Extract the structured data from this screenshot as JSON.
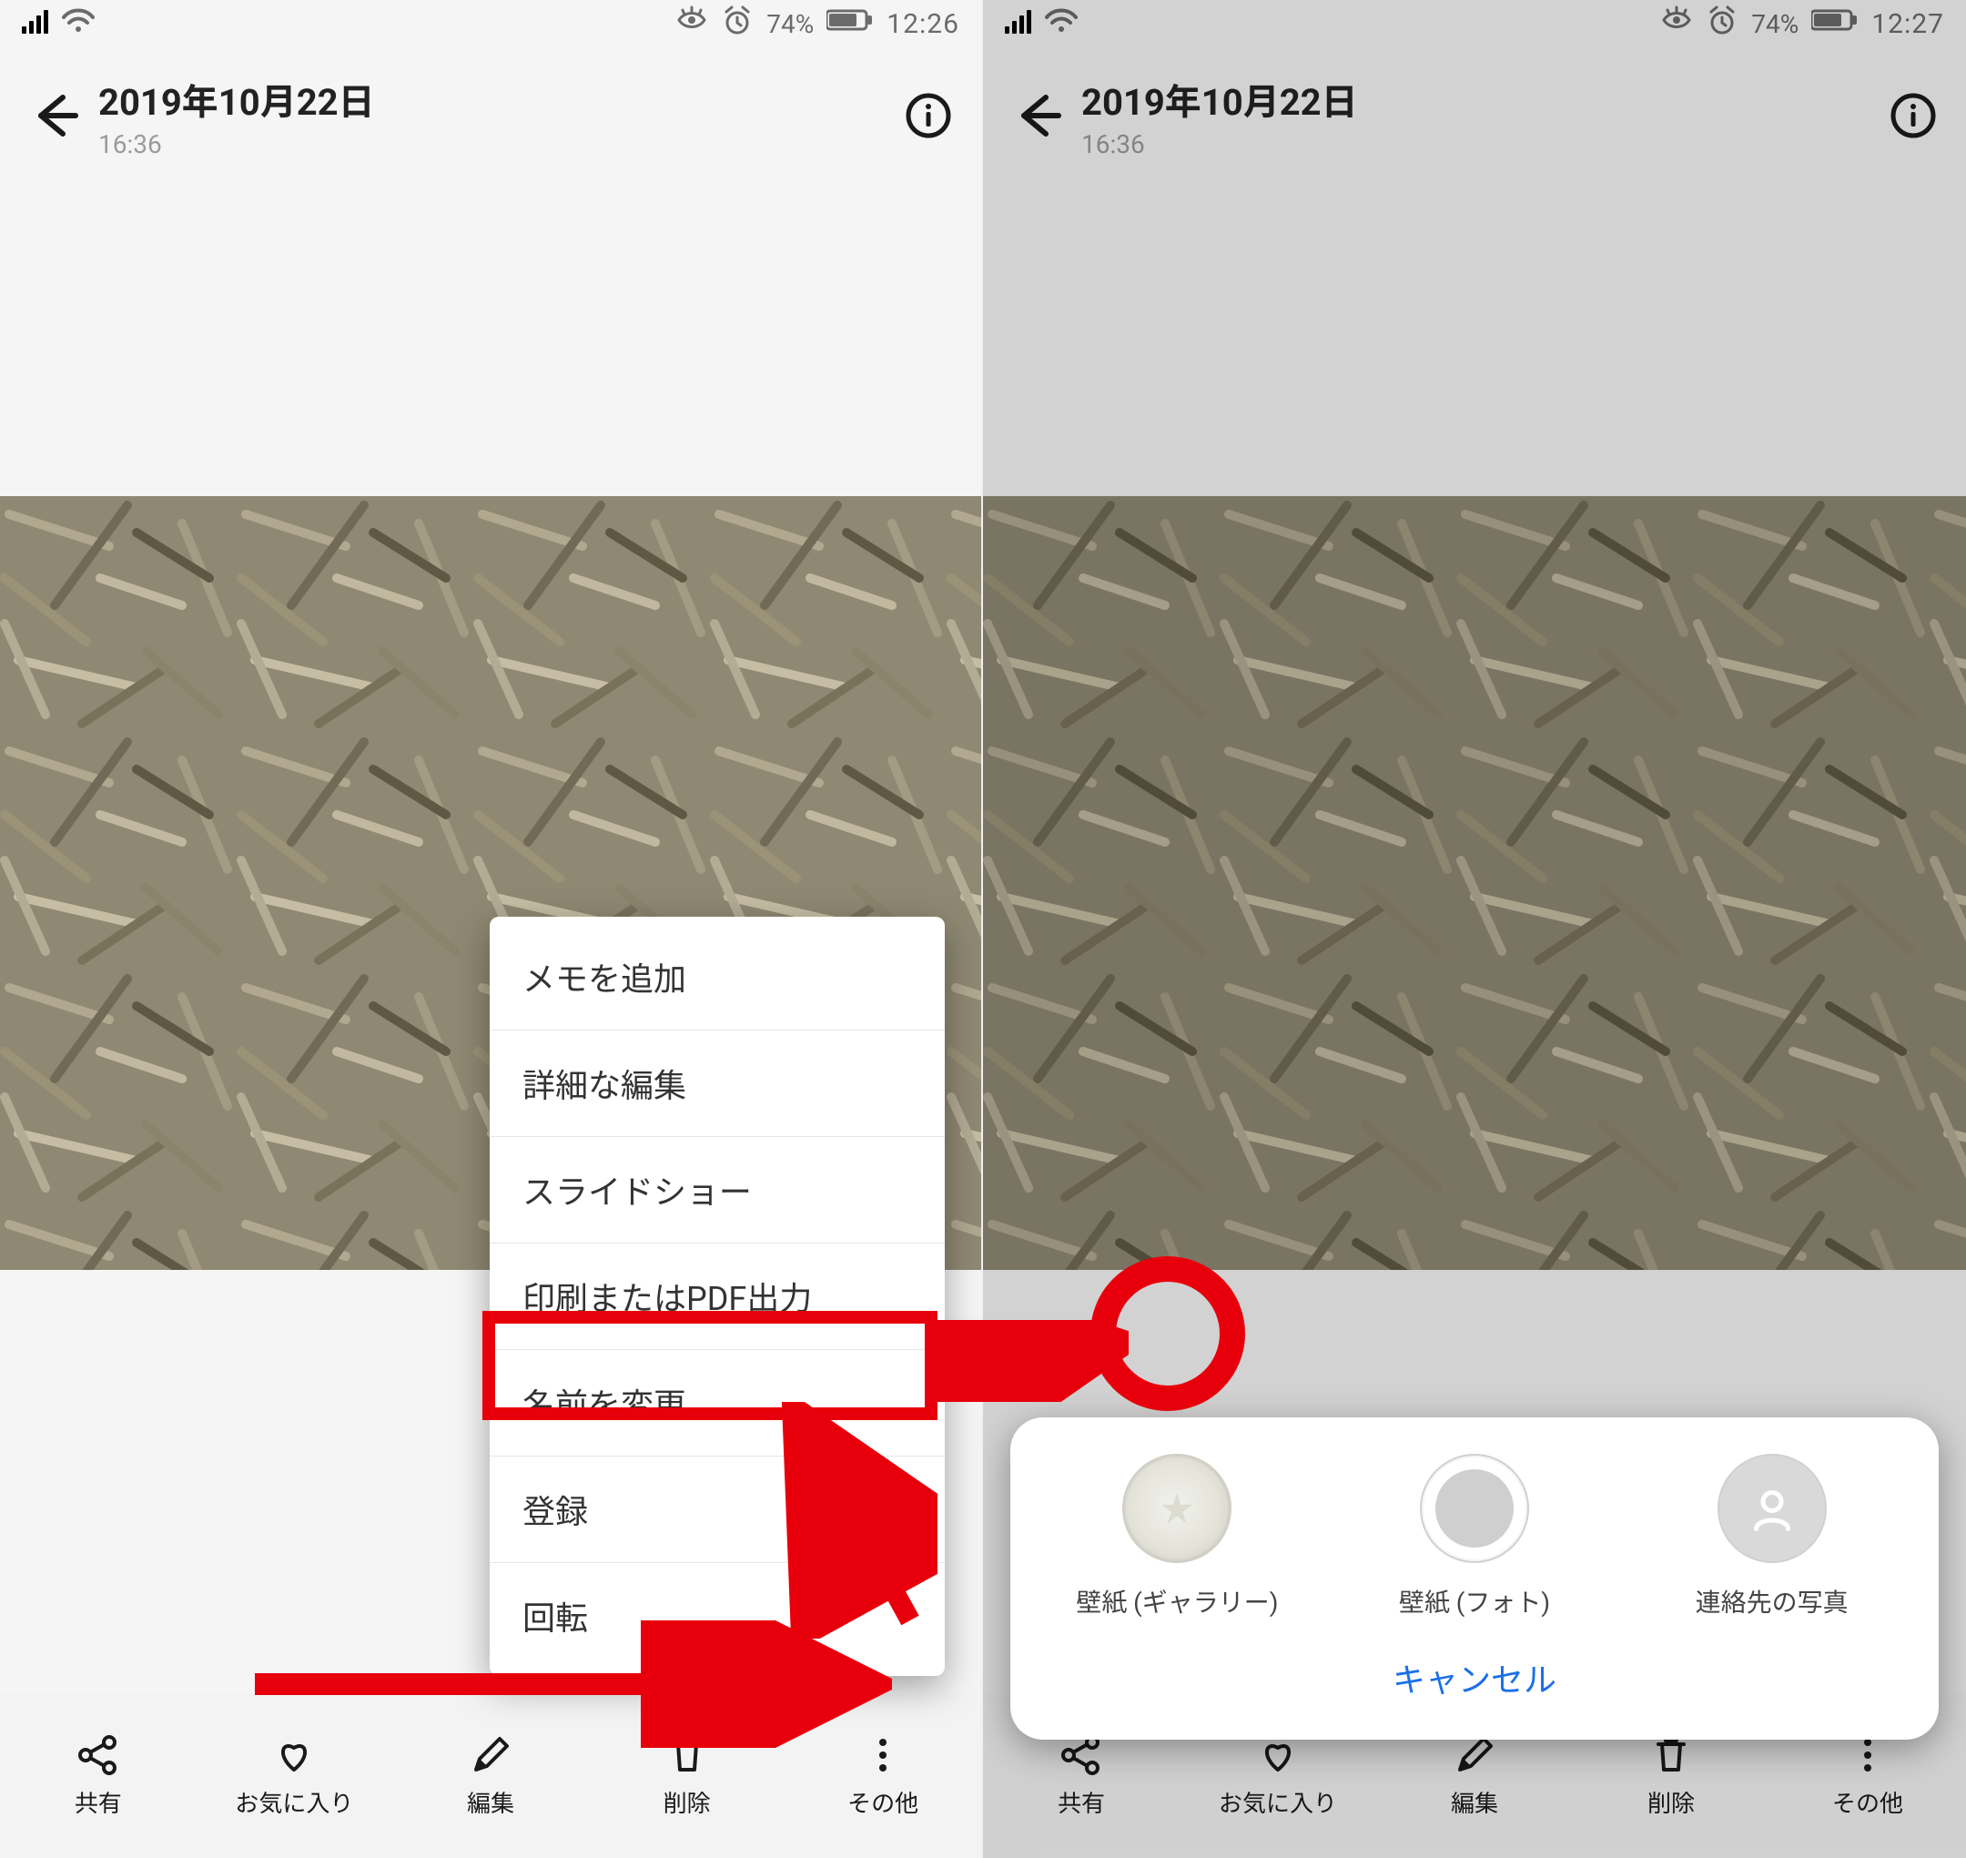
{
  "left": {
    "status": {
      "battery_pct": "74%",
      "time": "12:26"
    },
    "header": {
      "date": "2019年10月22日",
      "time": "16:36"
    },
    "popover": {
      "items": [
        {
          "label": "メモを追加"
        },
        {
          "label": "詳細な編集"
        },
        {
          "label": "スライドショー"
        },
        {
          "label": "印刷またはPDF出力"
        },
        {
          "label": "名前を変更"
        },
        {
          "label": "登録"
        },
        {
          "label": "回転"
        }
      ]
    },
    "toolbar": {
      "share": "共有",
      "favorite": "お気に入り",
      "edit": "編集",
      "delete": "削除",
      "more": "その他"
    }
  },
  "right": {
    "status": {
      "battery_pct": "74%",
      "time": "12:27"
    },
    "header": {
      "date": "2019年10月22日",
      "time": "16:36"
    },
    "sheet": {
      "options": [
        {
          "label": "壁紙 (ギャラリー)"
        },
        {
          "label": "壁紙 (フォト)"
        },
        {
          "label": "連絡先の写真"
        }
      ],
      "cancel": "キャンセル"
    },
    "toolbar": {
      "share": "共有",
      "favorite": "お気に入り",
      "edit": "編集",
      "delete": "削除",
      "more": "その他"
    }
  }
}
